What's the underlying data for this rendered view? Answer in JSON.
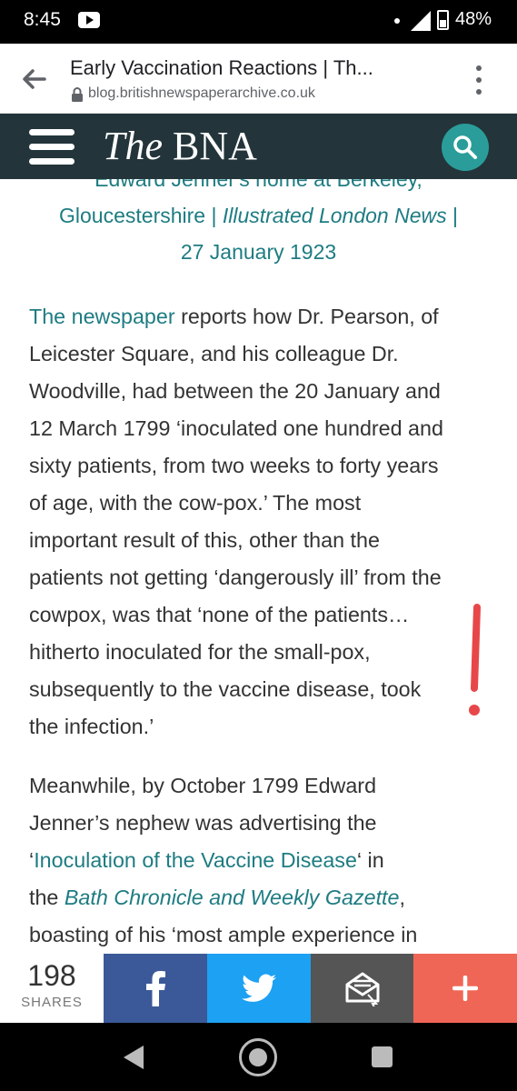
{
  "status": {
    "time": "8:45",
    "battery": "48%"
  },
  "browser": {
    "title": "Early Vaccination Reactions | Th...",
    "url": "blog.britishnewspaperarchive.co.uk"
  },
  "site": {
    "logo_the": "The",
    "logo_bna": "BNA"
  },
  "caption": {
    "line0": "Edward Jenner's home at Berkeley,",
    "line1_place": "Gloucestershire | ",
    "line1_pub": "Illustrated London News",
    "line1_sep": " |",
    "line2": "27 January 1923"
  },
  "para1": {
    "link": "The newspaper",
    "line0_rest": " reports how Dr. Pearson, of",
    "line1": "Leicester Square, and his colleague Dr.",
    "line2": "Woodville, had between the 20 January and",
    "line3": "12 March 1799 ‘inoculated one hundred and",
    "line4": "sixty patients, from two weeks to forty years",
    "line5": "of age, with the cow-pox.’ The most",
    "line6": "important result of this, other than the",
    "line7": "patients not getting ‘dangerously ill’ from the",
    "line8": "cowpox, was that ‘none of the patients…",
    "line9": "hitherto inoculated for the small-pox,",
    "line10": "subsequently to the vaccine disease, took",
    "line11": "the infection.’"
  },
  "para2": {
    "line0": "Meanwhile, by October 1799 Edward",
    "line1": "Jenner’s nephew was advertising the",
    "line2_pre": "‘",
    "line2_link": "Inoculation of the Vaccine Disease",
    "line2_post": "‘ in",
    "line3_pre": "the ",
    "line3_link": "Bath Chronicle and Weekly Gazette",
    "line3_post": ",",
    "line4": "boasting of his ‘most ample experience in"
  },
  "share": {
    "count": "198",
    "label": "SHARES"
  },
  "colors": {
    "header_bg": "#23353a",
    "accent_teal": "#1e7c82",
    "facebook": "#3b5998",
    "twitter": "#1da1f2",
    "email": "#555555",
    "more": "#f06656",
    "annotation_red": "#e8474a"
  },
  "icons": {
    "back": "back-arrow-icon",
    "lock": "lock-icon",
    "menu": "kebab-menu-icon",
    "hamburger": "hamburger-icon",
    "search": "search-icon",
    "facebook": "facebook-icon",
    "twitter": "twitter-icon",
    "email": "email-icon",
    "more": "plus-icon"
  }
}
